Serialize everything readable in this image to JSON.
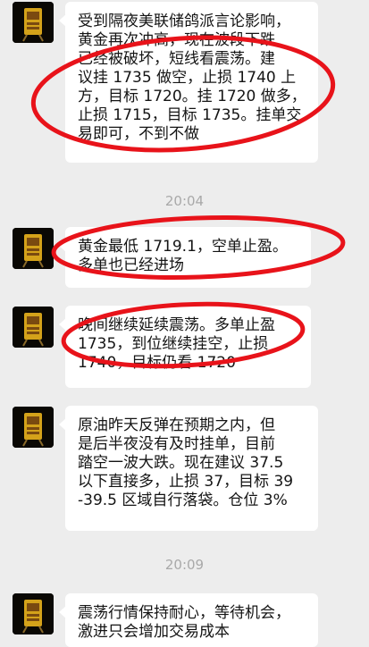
{
  "messages": [
    {
      "text": "受到隔夜美联储鸽派言论影响，\n黄金再次冲高，现在波段下跌\n已经被破坏，短线看震荡。建\n议挂 1735 做空，止损 1740 上\n方，目标 1720。挂 1720 做多，\n止损 1715，目标 1735。挂单交\n易即可，不到不做"
    },
    {
      "text": "黄金最低 1719.1，空单止盈。\n多单也已经进场"
    },
    {
      "text": "晚间继续延续震荡。多单止盈\n1735，到位继续挂空，止损\n1740，目标仍看 1720"
    },
    {
      "text": "原油昨天反弹在预期之内，但\n是后半夜没有及时挂单，目前\n踏空一波大跌。现在建议 37.5\n以下直接多，止损 37，目标 39\n-39.5 区域自行落袋。仓位 3%"
    },
    {
      "text": "震荡行情保持耐心，等待机会，\n激进只会增加交易成本"
    }
  ],
  "timestamps": [
    "20:04",
    "20:09"
  ],
  "colors": {
    "background": "#ededed",
    "bubble": "#ffffff",
    "annotation": "#e8131a",
    "avatar_bg": "#0a0804",
    "avatar_accent": "#d4a21a"
  }
}
